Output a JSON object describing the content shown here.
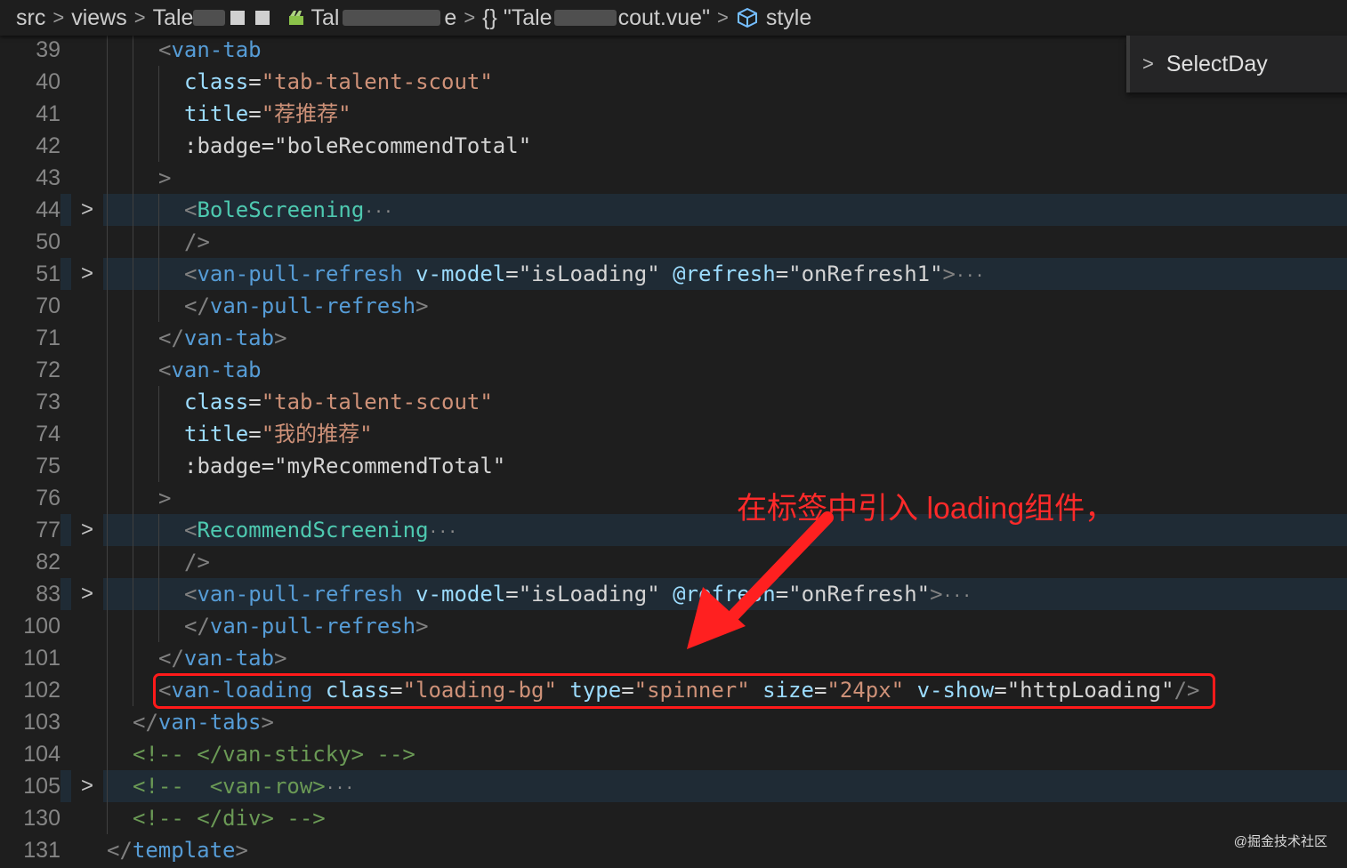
{
  "breadcrumb": {
    "items": [
      {
        "label": "src",
        "icon": null
      },
      {
        "label": "views",
        "icon": null
      },
      {
        "label": "Tale",
        "icon": null
      },
      {
        "label": "Tal",
        "icon": "folder-green"
      },
      {
        "label": "{} \"Tale",
        "icon": null
      },
      {
        "label": "cout.vue\"",
        "icon": null
      },
      {
        "label": "style",
        "icon": "cube-icon"
      }
    ]
  },
  "sticky_scroll": {
    "label": "SelectDay"
  },
  "colors": {
    "background": "#1e1e1e",
    "tag": "#569cd6",
    "component": "#4ec9b0",
    "attribute": "#9cdcfe",
    "string": "#ce9178",
    "comment": "#6a9955",
    "annotation_red": "#ff2a2a"
  },
  "lines": [
    {
      "n": "39",
      "indent": 2,
      "fold": false,
      "hl": false,
      "tokens": [
        [
          "p",
          "<"
        ],
        [
          "tag",
          "van-tab"
        ]
      ]
    },
    {
      "n": "40",
      "indent": 3,
      "fold": false,
      "hl": false,
      "tokens": [
        [
          "attr",
          "class"
        ],
        [
          "txt",
          "="
        ],
        [
          "str",
          "\"tab-talent-scout\""
        ]
      ]
    },
    {
      "n": "41",
      "indent": 3,
      "fold": false,
      "hl": false,
      "tokens": [
        [
          "attr",
          "title"
        ],
        [
          "txt",
          "="
        ],
        [
          "str",
          "\"荐推荐\""
        ]
      ]
    },
    {
      "n": "42",
      "indent": 3,
      "fold": false,
      "hl": false,
      "tokens": [
        [
          "txt",
          ":badge"
        ],
        [
          "txt",
          "="
        ],
        [
          "txt",
          "\"boleRecommendTotal\""
        ]
      ]
    },
    {
      "n": "43",
      "indent": 2,
      "fold": false,
      "hl": false,
      "tokens": [
        [
          "p",
          ">"
        ]
      ]
    },
    {
      "n": "44",
      "indent": 3,
      "fold": true,
      "hl": true,
      "tokens": [
        [
          "p",
          "<"
        ],
        [
          "comp",
          "BoleScreening"
        ],
        [
          "ell",
          "···"
        ]
      ]
    },
    {
      "n": "50",
      "indent": 3,
      "fold": false,
      "hl": false,
      "tokens": [
        [
          "p",
          "/>"
        ]
      ]
    },
    {
      "n": "51",
      "indent": 3,
      "fold": true,
      "hl": true,
      "tokens": [
        [
          "p",
          "<"
        ],
        [
          "tag",
          "van-pull-refresh"
        ],
        [
          "txt",
          " "
        ],
        [
          "attr",
          "v-model"
        ],
        [
          "txt",
          "="
        ],
        [
          "txt",
          "\"isLoading\""
        ],
        [
          "txt",
          " "
        ],
        [
          "attr",
          "@refresh"
        ],
        [
          "txt",
          "="
        ],
        [
          "txt",
          "\"onRefresh1\""
        ],
        [
          "p",
          ">"
        ],
        [
          "ell",
          "···"
        ]
      ]
    },
    {
      "n": "70",
      "indent": 3,
      "fold": false,
      "hl": false,
      "tokens": [
        [
          "p",
          "</"
        ],
        [
          "tag",
          "van-pull-refresh"
        ],
        [
          "p",
          ">"
        ]
      ]
    },
    {
      "n": "71",
      "indent": 2,
      "fold": false,
      "hl": false,
      "tokens": [
        [
          "p",
          "</"
        ],
        [
          "tag",
          "van-tab"
        ],
        [
          "p",
          ">"
        ]
      ]
    },
    {
      "n": "72",
      "indent": 2,
      "fold": false,
      "hl": false,
      "tokens": [
        [
          "p",
          "<"
        ],
        [
          "tag",
          "van-tab"
        ]
      ]
    },
    {
      "n": "73",
      "indent": 3,
      "fold": false,
      "hl": false,
      "tokens": [
        [
          "attr",
          "class"
        ],
        [
          "txt",
          "="
        ],
        [
          "str",
          "\"tab-talent-scout\""
        ]
      ]
    },
    {
      "n": "74",
      "indent": 3,
      "fold": false,
      "hl": false,
      "tokens": [
        [
          "attr",
          "title"
        ],
        [
          "txt",
          "="
        ],
        [
          "str",
          "\"我的推荐\""
        ]
      ]
    },
    {
      "n": "75",
      "indent": 3,
      "fold": false,
      "hl": false,
      "tokens": [
        [
          "txt",
          ":badge"
        ],
        [
          "txt",
          "="
        ],
        [
          "txt",
          "\"myRecommendTotal\""
        ]
      ]
    },
    {
      "n": "76",
      "indent": 2,
      "fold": false,
      "hl": false,
      "tokens": [
        [
          "p",
          ">"
        ]
      ]
    },
    {
      "n": "77",
      "indent": 3,
      "fold": true,
      "hl": true,
      "tokens": [
        [
          "p",
          "<"
        ],
        [
          "comp",
          "RecommendScreening"
        ],
        [
          "ell",
          "···"
        ]
      ]
    },
    {
      "n": "82",
      "indent": 3,
      "fold": false,
      "hl": false,
      "tokens": [
        [
          "p",
          "/>"
        ]
      ]
    },
    {
      "n": "83",
      "indent": 3,
      "fold": true,
      "hl": true,
      "tokens": [
        [
          "p",
          "<"
        ],
        [
          "tag",
          "van-pull-refresh"
        ],
        [
          "txt",
          " "
        ],
        [
          "attr",
          "v-model"
        ],
        [
          "txt",
          "="
        ],
        [
          "txt",
          "\"isLoading\""
        ],
        [
          "txt",
          " "
        ],
        [
          "attr",
          "@refresh"
        ],
        [
          "txt",
          "="
        ],
        [
          "txt",
          "\"onRefresh\""
        ],
        [
          "p",
          ">"
        ],
        [
          "ell",
          "···"
        ]
      ]
    },
    {
      "n": "100",
      "indent": 3,
      "fold": false,
      "hl": false,
      "tokens": [
        [
          "p",
          "</"
        ],
        [
          "tag",
          "van-pull-refresh"
        ],
        [
          "p",
          ">"
        ]
      ]
    },
    {
      "n": "101",
      "indent": 2,
      "fold": false,
      "hl": false,
      "tokens": [
        [
          "p",
          "</"
        ],
        [
          "tag",
          "van-tab"
        ],
        [
          "p",
          ">"
        ]
      ]
    },
    {
      "n": "102",
      "indent": 2,
      "fold": false,
      "hl": false,
      "tokens": [
        [
          "p",
          "<"
        ],
        [
          "tag",
          "van-loading"
        ],
        [
          "txt",
          " "
        ],
        [
          "attr",
          "class"
        ],
        [
          "txt",
          "="
        ],
        [
          "str",
          "\"loading-bg\""
        ],
        [
          "txt",
          " "
        ],
        [
          "attr",
          "type"
        ],
        [
          "txt",
          "="
        ],
        [
          "str",
          "\"spinner\""
        ],
        [
          "txt",
          " "
        ],
        [
          "attr",
          "size"
        ],
        [
          "txt",
          "="
        ],
        [
          "str",
          "\"24px\""
        ],
        [
          "txt",
          " "
        ],
        [
          "attr",
          "v-show"
        ],
        [
          "txt",
          "="
        ],
        [
          "txt",
          "\"httpLoading\""
        ],
        [
          "p",
          "/>"
        ]
      ]
    },
    {
      "n": "103",
      "indent": 1,
      "fold": false,
      "hl": false,
      "tokens": [
        [
          "p",
          "</"
        ],
        [
          "tag",
          "van-tabs"
        ],
        [
          "p",
          ">"
        ]
      ]
    },
    {
      "n": "104",
      "indent": 1,
      "fold": false,
      "hl": false,
      "tokens": [
        [
          "cmt",
          "<!-- </van-sticky> -->"
        ]
      ]
    },
    {
      "n": "105",
      "indent": 1,
      "fold": true,
      "hl": true,
      "tokens": [
        [
          "cmt",
          "<!--  <van-row>"
        ],
        [
          "ell",
          "···"
        ]
      ]
    },
    {
      "n": "130",
      "indent": 1,
      "fold": false,
      "hl": false,
      "tokens": [
        [
          "cmt",
          "<!-- </div> -->"
        ]
      ]
    },
    {
      "n": "131",
      "indent": 0,
      "fold": false,
      "hl": false,
      "tokens": [
        [
          "p",
          "</"
        ],
        [
          "tag",
          "template"
        ],
        [
          "p",
          ">"
        ]
      ]
    }
  ],
  "annotation": {
    "text": "在标签中引入 loading组件，"
  },
  "watermark": {
    "text": "@掘金技术社区"
  }
}
